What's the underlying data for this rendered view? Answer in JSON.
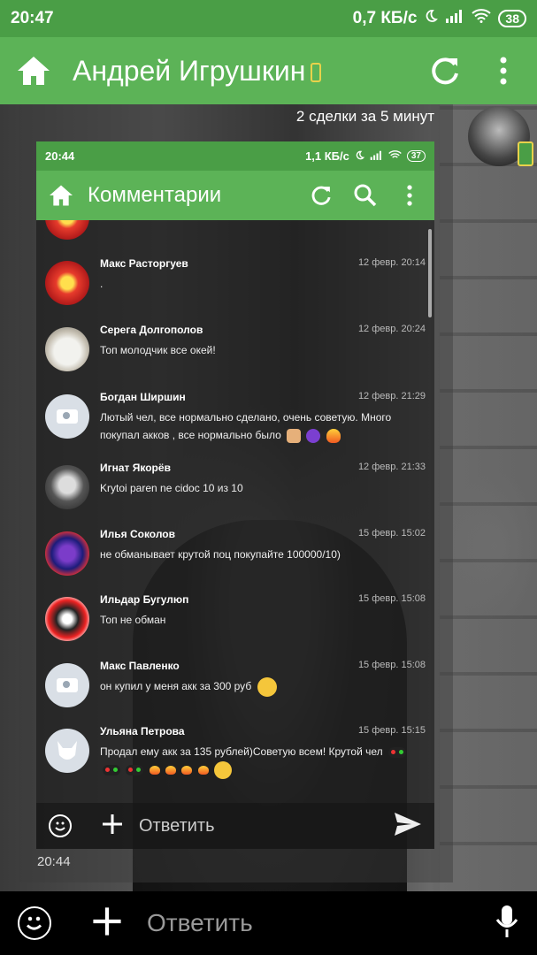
{
  "status_bar": {
    "time": "20:47",
    "network_speed": "0,7 КБ/с",
    "battery": "38",
    "icons": [
      "moon-icon",
      "signal-icon",
      "wifi-icon",
      "battery-icon"
    ]
  },
  "app_bar": {
    "title": "Андрей Игрушкин",
    "icons": [
      "home-icon",
      "phone-icon",
      "refresh-icon",
      "more-vert-icon"
    ],
    "color": "#5cb357",
    "status_color": "#4a9e46"
  },
  "message": {
    "caption": "2 сделки за 5 минут",
    "time": "20:44"
  },
  "embedded": {
    "status_bar": {
      "time": "20:44",
      "network_speed": "1,1 КБ/с",
      "battery": "37"
    },
    "app_bar": {
      "title": "Комментарии"
    },
    "comments": [
      {
        "name": "Макс Расторгуев",
        "date": "12 февр. 20:14",
        "text": ".",
        "avatar": "red"
      },
      {
        "name": "Серега Долгополов",
        "date": "12 февр. 20:24",
        "text": "Топ молодчик все окей!",
        "avatar": "cat"
      },
      {
        "name": "Богдан Ширшин",
        "date": "12 февр. 21:29",
        "text": "Лютый чел, все нормально сделано, очень советую. Много покупал акков , все нормально было",
        "avatar": "photo"
      },
      {
        "name": "Игнат Якорёв",
        "date": "12 февр. 21:33",
        "text": "Krytoi paren ne cidoc 10 из 10",
        "avatar": "hat"
      },
      {
        "name": "Илья Соколов",
        "date": "15 февр. 15:02",
        "text": "не обманывает крутой поц покупайте 100000/10)",
        "avatar": "face"
      },
      {
        "name": "Ильдар Бугулюп",
        "date": "15 февр. 15:08",
        "text": "Топ не обман",
        "avatar": "mouse"
      },
      {
        "name": "Макс Павленко",
        "date": "15 февр. 15:08",
        "text": "он купил у меня акк за 300 руб",
        "avatar": "photo"
      },
      {
        "name": "Ульяна Петрова",
        "date": "15 февр. 15:15",
        "text": "Продал ему акк за 135 рублей)Советую всем! Крутой чел",
        "avatar": "vk"
      }
    ],
    "input_placeholder": "Ответить"
  },
  "input_bar": {
    "placeholder": "Ответить"
  }
}
